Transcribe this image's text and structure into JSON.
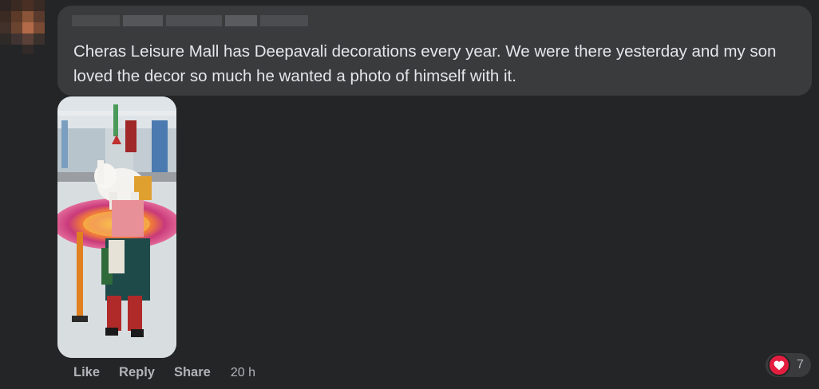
{
  "comment": {
    "text": "Cheras Leisure Mall has Deepavali decorations every year. We were there yesterday and my son loved the decor so much he wanted a photo of himself with it."
  },
  "attachment": {
    "type": "photo"
  },
  "actions": {
    "like": "Like",
    "reply": "Reply",
    "share": "Share",
    "timestamp": "20 h"
  },
  "reactions": {
    "icon": "heart-icon",
    "count": "7",
    "color": "#e41e3f"
  },
  "colors": {
    "background": "#242526",
    "bubble": "#3a3b3c",
    "text": "#e4e6eb",
    "secondary_text": "#b0b3b8"
  }
}
